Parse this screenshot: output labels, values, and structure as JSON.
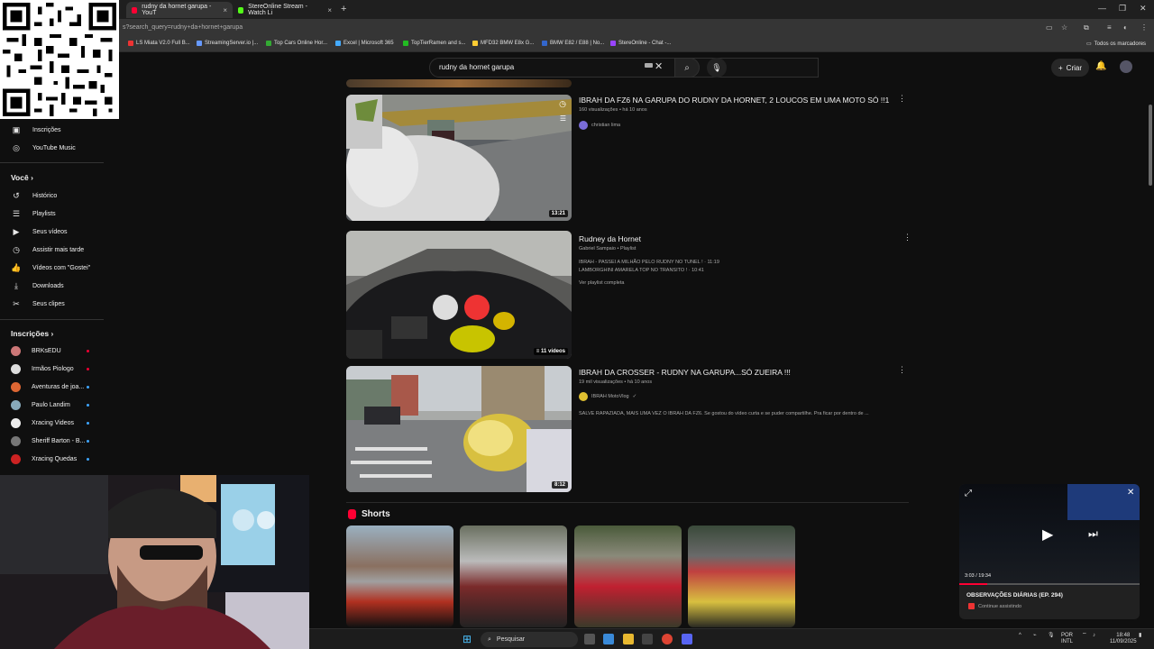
{
  "browser": {
    "tabs": [
      {
        "title": "rudny da hornet garupa - YouT",
        "active": true
      },
      {
        "title": "StereOnline Stream - Watch Li",
        "active": false
      }
    ],
    "url": "s?search_query=rudny+da+hornet+garupa",
    "bookmarks": [
      "LS Miata V2.0 Full B...",
      "StreamingServer.io |...",
      "Top Cars Online Hor...",
      "Excel | Microsoft 365",
      "TopTierRamen and s...",
      "MFD32 BMW E8x G...",
      "BMW E82 / E88 | No...",
      "StereOnline - Chat -..."
    ],
    "all_bookmarks": "Todos os marcadores"
  },
  "header": {
    "search_value": "rudny da hornet garupa",
    "create_label": "Criar"
  },
  "sidebar": {
    "top_items": [
      "Inscrições",
      "YouTube Music"
    ],
    "you_heading": "Você",
    "you_items": [
      "Histórico",
      "Playlists",
      "Seus vídeos",
      "Assistir mais tarde",
      "Vídeos com \"Gostei\"",
      "Downloads",
      "Seus clipes"
    ],
    "subs_heading": "Inscrições",
    "subs": [
      "BRKsEDU",
      "Irmãos Piologo",
      "Aventuras de joa...",
      "Paulo Landim",
      "Xracing Videos",
      "Sheriff Barton - B...",
      "Xracing Quedas"
    ]
  },
  "results": [
    {
      "title": "IBRAH DA FZ6 NA GARUPA DO RUDNY DA HORNET, 2 LOUCOS EM UMA MOTO SÓ !!1",
      "meta": "160 visualizações • há 10 anos",
      "channel": "christian lima",
      "duration": "13:21"
    },
    {
      "title": "Rudney da Hornet",
      "meta": "Gabriel Sampaio • Playlist",
      "line1": "IBRAH - PASSEI A MILHÃO PELO RUDNY NO TUNEL ! · 11:19",
      "line2": "LAMBORGHINI AMARELA TOP NO TRANSITO ! · 10:41",
      "link": "Ver playlist completa",
      "duration": "11 vídeos"
    },
    {
      "title": "IBRAH DA CROSSER - RUDNY NA GARUPA...SÓ ZUEIRA !!!",
      "meta": "19 mil visualizações • há 10 anos",
      "channel": "IBRAH MotoVlog",
      "desc": "SALVE RAPAZIADA, MAIS UMA VEZ O IBRAH DA FZ6. Se gostou do vídeo curta e se puder compartilhe. Pra ficar por dentro de ...",
      "duration": "8:12"
    }
  ],
  "shorts": {
    "heading": "Shorts"
  },
  "miniplayer": {
    "time": "3:03 / 19:34",
    "progress": 0.156,
    "title": "OBSERVAÇÕES DIÁRIAS (EP. 294)",
    "subtitle": "Continue assistindo"
  },
  "taskbar": {
    "search_label": "Pesquisar",
    "lang1": "POR",
    "lang2": "INTL",
    "time": "18:48",
    "date": "11/09/2025"
  }
}
